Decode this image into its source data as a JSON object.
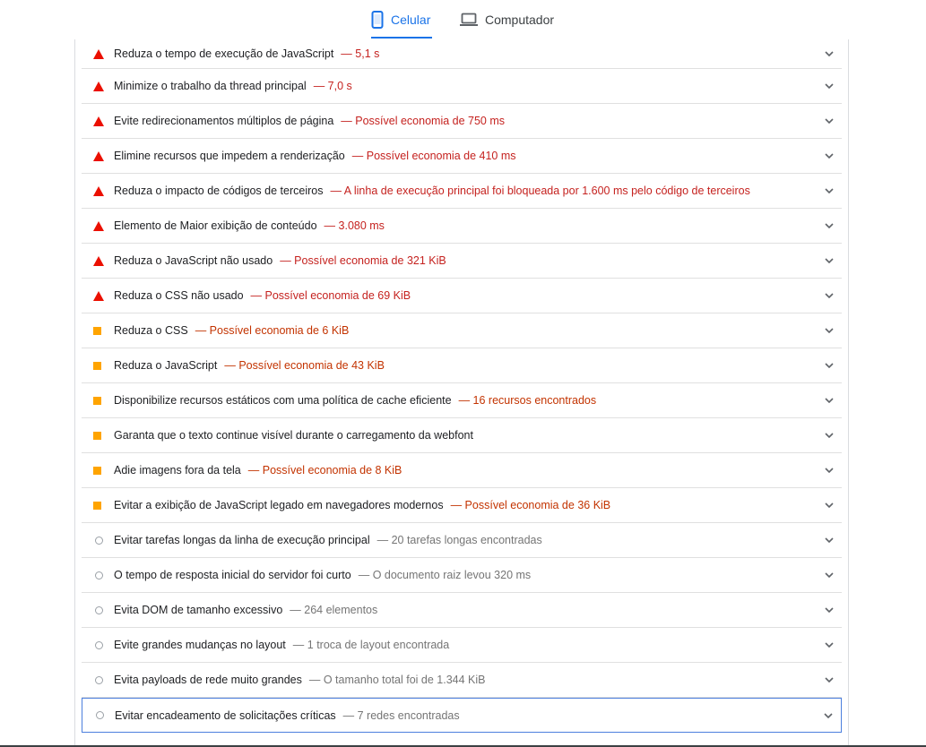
{
  "tabs": {
    "mobile": {
      "label": "Celular",
      "icon": "smartphone-icon",
      "active": true
    },
    "desktop": {
      "label": "Computador",
      "icon": "laptop-icon",
      "active": false
    }
  },
  "colors": {
    "fail": "#eb0f00",
    "average": "#ffa400",
    "info": "#9aa0a6",
    "accent": "#1a73e8"
  },
  "audits": [
    {
      "status": "fail",
      "title": "Reduza o tempo de execução de JavaScript",
      "detail": "— 5,1 s"
    },
    {
      "status": "fail",
      "title": "Minimize o trabalho da thread principal",
      "detail": "— 7,0 s"
    },
    {
      "status": "fail",
      "title": "Evite redirecionamentos múltiplos de página",
      "detail": "— Possível economia de 750 ms"
    },
    {
      "status": "fail",
      "title": "Elimine recursos que impedem a renderização",
      "detail": "— Possível economia de 410 ms"
    },
    {
      "status": "fail",
      "title": "Reduza o impacto de códigos de terceiros",
      "detail": "— A linha de execução principal foi bloqueada por 1.600 ms pelo código de terceiros"
    },
    {
      "status": "fail",
      "title": "Elemento de Maior exibição de conteúdo",
      "detail": "— 3.080 ms"
    },
    {
      "status": "fail",
      "title": "Reduza o JavaScript não usado",
      "detail": "— Possível economia de 321 KiB"
    },
    {
      "status": "fail",
      "title": "Reduza o CSS não usado",
      "detail": "— Possível economia de 69 KiB"
    },
    {
      "status": "average",
      "title": "Reduza o CSS",
      "detail": "— Possível economia de 6 KiB"
    },
    {
      "status": "average",
      "title": "Reduza o JavaScript",
      "detail": "— Possível economia de 43 KiB"
    },
    {
      "status": "average",
      "title": "Disponibilize recursos estáticos com uma política de cache eficiente",
      "detail": "— 16 recursos encontrados"
    },
    {
      "status": "average",
      "title": "Garanta que o texto continue visível durante o carregamento da webfont",
      "detail": ""
    },
    {
      "status": "average",
      "title": "Adie imagens fora da tela",
      "detail": "— Possível economia de 8 KiB"
    },
    {
      "status": "average",
      "title": "Evitar a exibição de JavaScript legado em navegadores modernos",
      "detail": "— Possível economia de 36 KiB"
    },
    {
      "status": "info",
      "title": "Evitar tarefas longas da linha de execução principal",
      "detail": "— 20 tarefas longas encontradas"
    },
    {
      "status": "info",
      "title": "O tempo de resposta inicial do servidor foi curto",
      "detail": "— O documento raiz levou 320 ms"
    },
    {
      "status": "info",
      "title": "Evita DOM de tamanho excessivo",
      "detail": "— 264 elementos"
    },
    {
      "status": "info",
      "title": "Evite grandes mudanças no layout",
      "detail": "— 1 troca de layout encontrada"
    },
    {
      "status": "info",
      "title": "Evita payloads de rede muito grandes",
      "detail": "— O tamanho total foi de 1.344 KiB"
    },
    {
      "status": "info",
      "title": "Evitar encadeamento de solicitações críticas",
      "detail": "— 7 redes encontradas"
    }
  ]
}
